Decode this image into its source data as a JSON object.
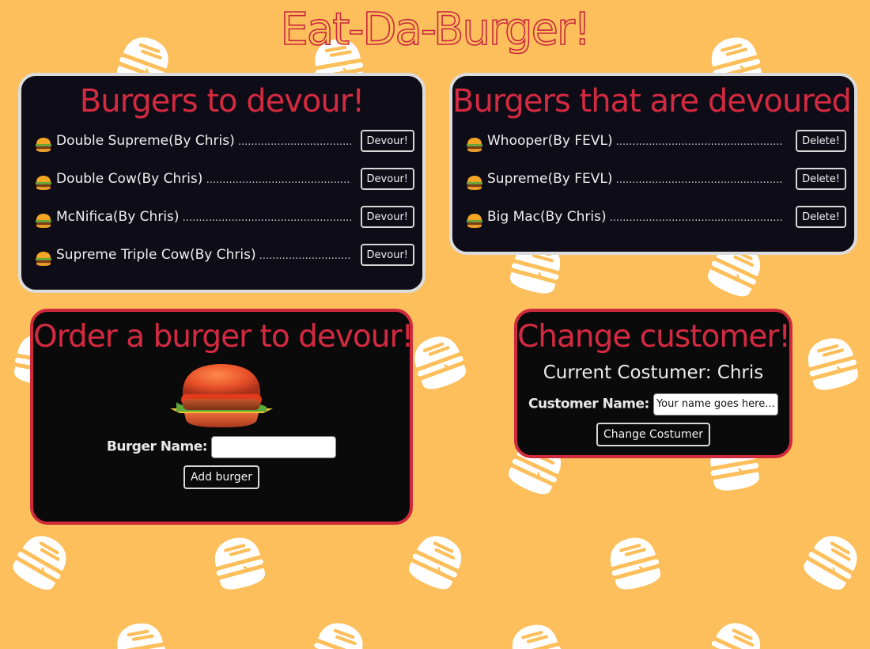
{
  "page": {
    "title": "Eat-Da-Burger!"
  },
  "colors": {
    "background": "#fdbf5b",
    "accent_red": "#d42a41",
    "panel_dark": "#0e0c16",
    "panel_border_light": "#dcdcdc",
    "panel_border_red": "#cf2b3c",
    "pattern_icon": "#ffffff"
  },
  "devour_panel": {
    "heading": "Burgers to devour!",
    "items": [
      {
        "icon": "burger-icon",
        "label": "Double Supreme(By Chris)",
        "button": "Devour!"
      },
      {
        "icon": "burger-icon",
        "label": "Double Cow(By Chris)",
        "button": "Devour!"
      },
      {
        "icon": "burger-icon",
        "label": "McNifica(By Chris)",
        "button": "Devour!"
      },
      {
        "icon": "burger-icon",
        "label": "Supreme Triple Cow(By Chris)",
        "button": "Devour!"
      }
    ]
  },
  "devoured_panel": {
    "heading": "Burgers that are devoured!",
    "items": [
      {
        "icon": "burger-icon",
        "label": "Whooper(By FEVL)",
        "button": "Delete!"
      },
      {
        "icon": "burger-icon",
        "label": "Supreme(By FEVL)",
        "button": "Delete!"
      },
      {
        "icon": "burger-icon",
        "label": "Big Mac(By Chris)",
        "button": "Delete!"
      }
    ]
  },
  "order_panel": {
    "heading": "Order a burger to devour!",
    "image": "burger-illustration",
    "name_label": "Burger Name:",
    "name_value": "",
    "submit_label": "Add burger"
  },
  "customer_panel": {
    "heading": "Change customer!",
    "current_label": "Current Costumer: Chris",
    "name_label": "Customer Name:",
    "name_placeholder": "Your name goes here...",
    "submit_label": "Change Costumer"
  }
}
